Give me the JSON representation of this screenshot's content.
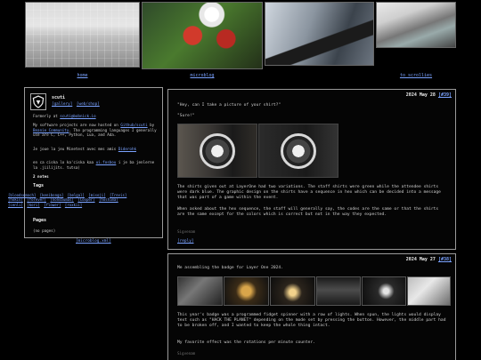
{
  "banner": {
    "captions": [
      "home",
      "microblog",
      "",
      "to scrollies"
    ]
  },
  "profile": {
    "name": "scuti",
    "link_gallery": "[gallery]",
    "link_shop": "[web/shop]",
    "formerly": "Formerly at",
    "formerly_link": "scuti@bobnick.io",
    "software_1": "My software projects are now hosted on",
    "software_link_1": "Github/scuti",
    "software_2": "by",
    "software_link_2": "Beanie Community",
    "software_3": ". The programming languages I generally use are C, C++, Python, Lua, and Ada.",
    "minetest_1": "Je joue la jeu Minetest avec mes amis",
    "minetest_link": "Diderohk",
    "irc_1": "en ca ciska lo ka'ciska kaa",
    "irc_link": "ui.fosbou",
    "irc_2": "i je ba jenlerne la .jiilijits. tutsa)",
    "notes": "2 notes",
    "tags_heading": "Tags",
    "tags": [
      "[bloodsemoch]",
      "[kenibonga]",
      "[belgal]",
      "[misoji]",
      "[Trevis]",
      "[hokis]",
      "[forever]",
      "[nonsbumas]",
      "[Cooper]",
      "[hoshima]",
      "[cenli]",
      "[kori]",
      "[flower]",
      "[roxkii]"
    ],
    "pages_heading": "Pages",
    "pages_value": "(no pages)",
    "atom_link": "[microblog.xml]"
  },
  "posts": [
    {
      "date": "2024 May 28",
      "anchor": "[#39]",
      "lines": [
        "\"Hey, can I take a picture of your shirt?\"",
        "\"Sure!\"",
        "The shirts given out at LayerOne had two variations. The staff shirts were green while the attendee shirts were dark blue. The graphic design on the shirts have a sequence in hex which can be decided into a message that was part of a game within the event.",
        "When asked about the hex sequence, the staff will generally say, the codes are the same or that the shirts are the same except for the colors which is correct but not in the way they expected."
      ],
      "meta": "Sigvenam",
      "reply": "[reply]"
    },
    {
      "date": "2024 May 27",
      "anchor": "[#38]",
      "lines": [
        "Me assembling the badge for Layer One 2024.",
        "This year's badge was a programmed fidget spinner with a row of lights. When spun, the lights would display text such as \"HACK THE PLANET\" depending on the mode set by pressing the button. However, the middle part had to be broken off, and I wanted to keep the whole thing intact.",
        "My favorite effect was the rotations per minute counter."
      ],
      "meta": "Sigvenam"
    }
  ]
}
